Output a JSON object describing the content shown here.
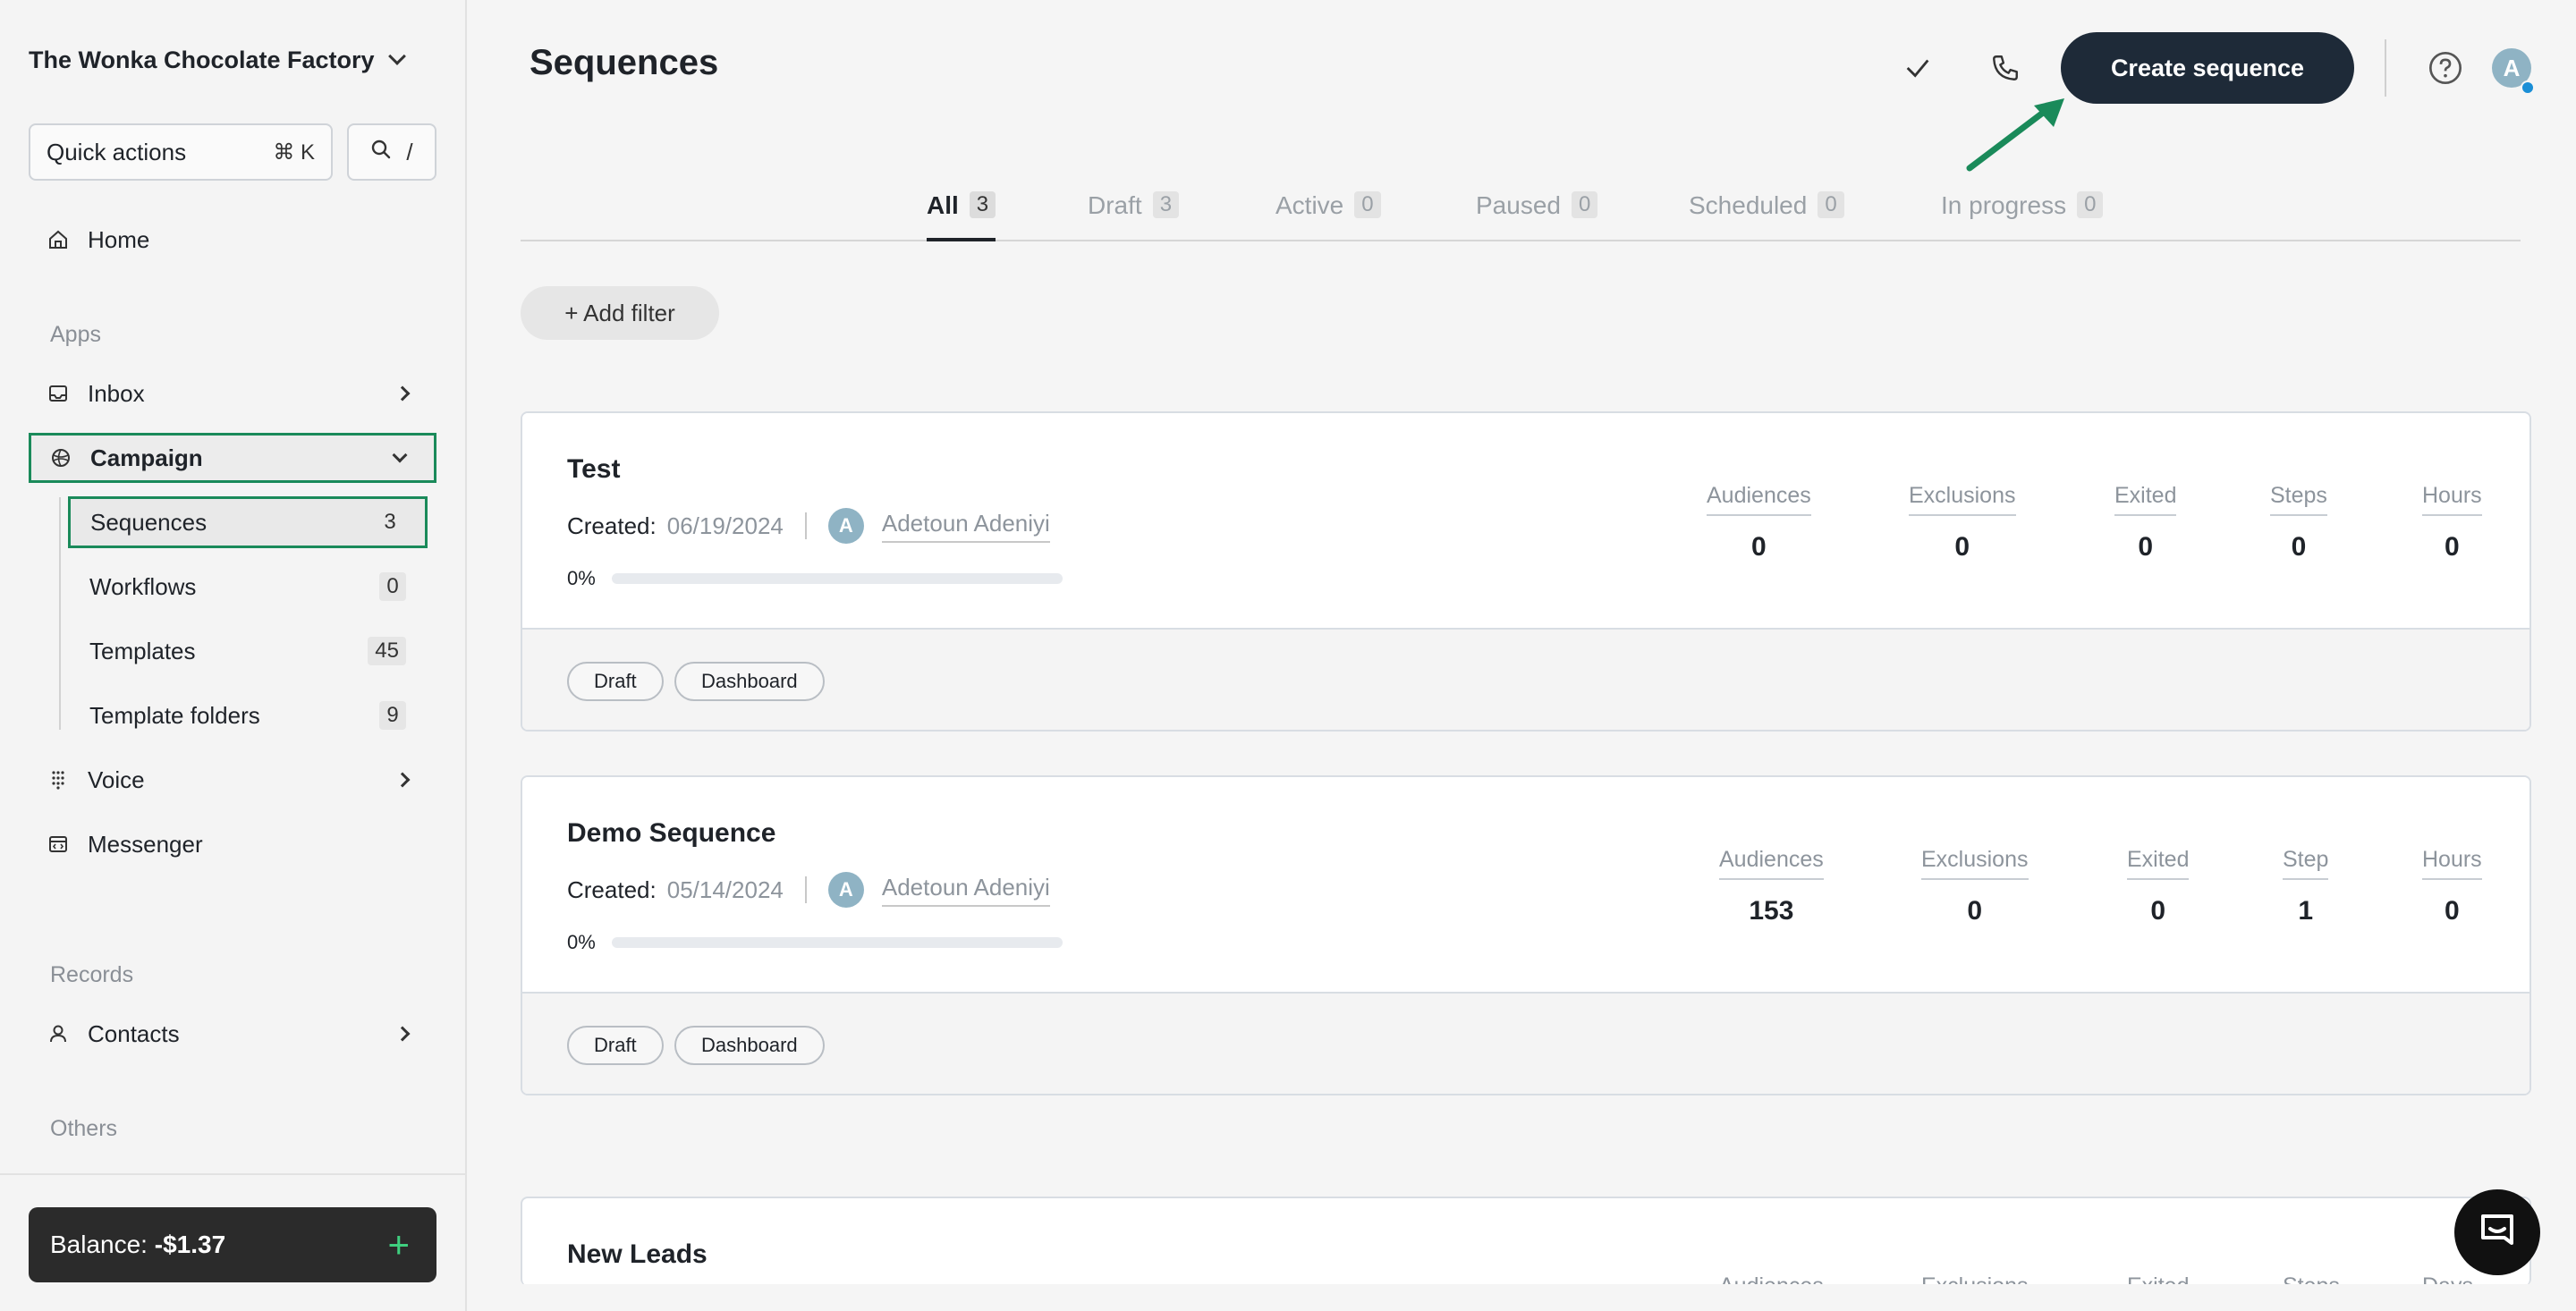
{
  "sidebar": {
    "org_name": "The Wonka Chocolate Factory",
    "quick_actions": {
      "label": "Quick actions",
      "shortcut": "⌘ K"
    },
    "search_shortcut": "/",
    "home": "Home",
    "apps_label": "Apps",
    "inbox": "Inbox",
    "campaign": "Campaign",
    "sub_items": [
      {
        "label": "Sequences",
        "count": "3"
      },
      {
        "label": "Workflows",
        "count": "0"
      },
      {
        "label": "Templates",
        "count": "45"
      },
      {
        "label": "Template folders",
        "count": "9"
      }
    ],
    "voice": "Voice",
    "messenger": "Messenger",
    "records_label": "Records",
    "contacts": "Contacts",
    "others_label": "Others",
    "balance_label": "Balance:",
    "balance_value": "-$1.37",
    "balance_add": "+"
  },
  "header": {
    "title": "Sequences",
    "create_button": "Create sequence",
    "avatar_initial": "A"
  },
  "tabs": [
    {
      "label": "All",
      "count": "3"
    },
    {
      "label": "Draft",
      "count": "3"
    },
    {
      "label": "Active",
      "count": "0"
    },
    {
      "label": "Paused",
      "count": "0"
    },
    {
      "label": "Scheduled",
      "count": "0"
    },
    {
      "label": "In progress",
      "count": "0"
    }
  ],
  "add_filter": "+ Add filter",
  "sequences": [
    {
      "title": "Test",
      "created_label": "Created:",
      "created_date": "06/19/2024",
      "owner_initial": "A",
      "owner": "Adetoun Adeniyi",
      "progress_label": "0%",
      "progress_fraction": 0,
      "stats": [
        {
          "label": "Audiences",
          "value": "0"
        },
        {
          "label": "Exclusions",
          "value": "0"
        },
        {
          "label": "Exited",
          "value": "0"
        },
        {
          "label": "Steps",
          "value": "0"
        },
        {
          "label": "Hours",
          "value": "0"
        }
      ],
      "status": "Draft",
      "dashboard": "Dashboard"
    },
    {
      "title": "Demo Sequence",
      "created_label": "Created:",
      "created_date": "05/14/2024",
      "owner_initial": "A",
      "owner": "Adetoun Adeniyi",
      "progress_label": "0%",
      "progress_fraction": 0,
      "stats": [
        {
          "label": "Audiences",
          "value": "153"
        },
        {
          "label": "Exclusions",
          "value": "0"
        },
        {
          "label": "Exited",
          "value": "0"
        },
        {
          "label": "Step",
          "value": "1"
        },
        {
          "label": "Hours",
          "value": "0"
        }
      ],
      "status": "Draft",
      "dashboard": "Dashboard"
    },
    {
      "title": "New Leads",
      "stats": [
        {
          "label": "Audiences"
        },
        {
          "label": "Exclusions"
        },
        {
          "label": "Exited"
        },
        {
          "label": "Steps"
        },
        {
          "label": "Days"
        }
      ]
    }
  ],
  "colors": {
    "accent_green": "#1a8a5a",
    "primary_button": "#1e2a38",
    "avatar": "#8fb3c4",
    "notification_dot": "#1a8ed6",
    "balance_plus": "#3fcf7f"
  },
  "icons": {
    "home": "home-icon",
    "inbox": "inbox-icon",
    "campaign": "globe-icon",
    "voice": "keypad-icon",
    "messenger": "messenger-icon",
    "contacts": "person-icon",
    "check": "check-icon",
    "phone": "phone-icon",
    "help": "help-icon",
    "chat": "chat-icon"
  }
}
